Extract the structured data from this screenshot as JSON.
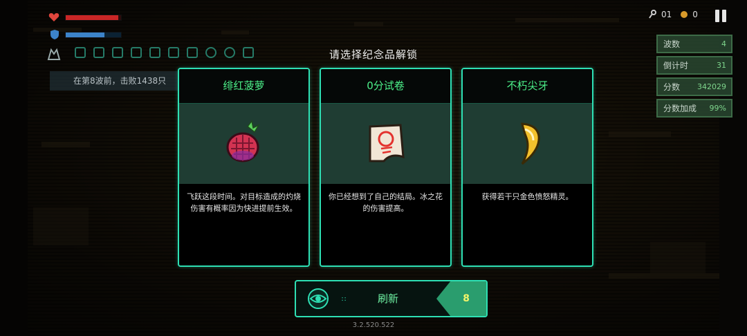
{
  "hud": {
    "health_fraction": 0.95,
    "shield_fraction": 0.7,
    "banner_text": "在第8波前，击败1438只",
    "keys": "01",
    "coins": "0"
  },
  "stats": [
    {
      "label": "波数",
      "value": "4"
    },
    {
      "label": "倒计时",
      "value": "31"
    },
    {
      "label": "分数",
      "value": "342029"
    },
    {
      "label": "分数加成",
      "value": "99%"
    }
  ],
  "title": "请选择纪念品解锁",
  "cards": [
    {
      "name": "绯红菠萝",
      "desc": "飞跃这段时间。对目标造成的灼烧伤害有概率因为快进提前生效。",
      "icon": "crimson-pineapple-icon"
    },
    {
      "name": "0分试卷",
      "desc": "你已经想到了自己的结局。冰之花的伤害提高。",
      "icon": "zero-score-paper-icon"
    },
    {
      "name": "不朽尖牙",
      "desc": "获得若干只金色愤怒精灵。",
      "icon": "immortal-fang-icon"
    }
  ],
  "refresh": {
    "label": "刷新",
    "count": "8"
  },
  "version": "3.2.520.522",
  "colors": {
    "accent": "#2ee0b4",
    "title_green": "#4cf089",
    "card_art_bg": "#1f3d33"
  }
}
